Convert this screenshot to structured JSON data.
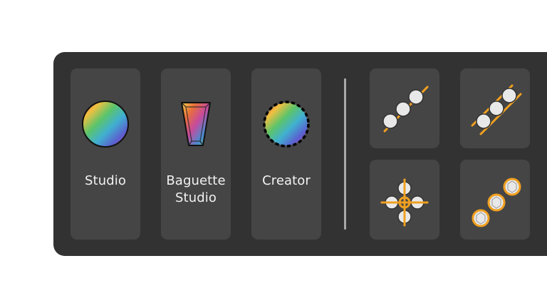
{
  "tools": [
    {
      "label": "Studio",
      "icon": "color-wheel-icon"
    },
    {
      "label": "Baguette\nStudio",
      "icon": "baguette-gem-icon"
    },
    {
      "label": "Creator",
      "icon": "dashed-color-wheel-icon"
    }
  ],
  "layouts": [
    {
      "icon": "diagonal-stone-line-icon"
    },
    {
      "icon": "channel-stone-row-icon"
    },
    {
      "icon": "cross-stone-cluster-icon"
    },
    {
      "icon": "bezel-stone-row-icon"
    }
  ],
  "colors": {
    "panel": "#323232",
    "tile": "#454545",
    "accent": "#f0a020",
    "label": "#f2f2f2"
  }
}
